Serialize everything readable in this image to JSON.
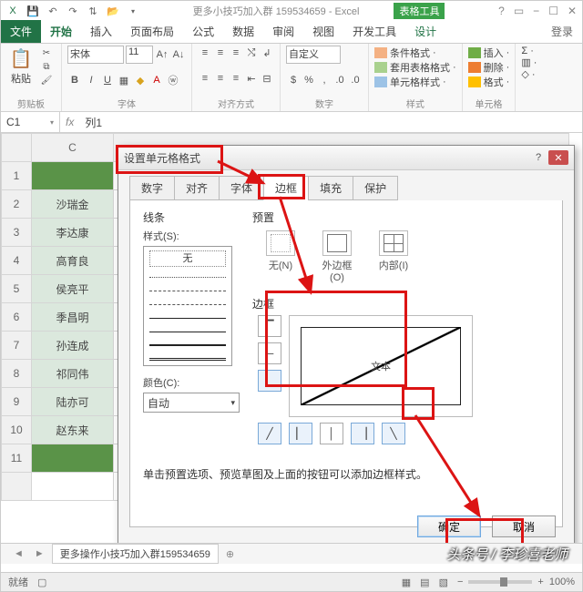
{
  "app": {
    "qat_icons": [
      "xl",
      "save",
      "undo",
      "redo",
      "sort",
      "open"
    ],
    "title_doc": "更多小技巧加入群 159534659 - Excel",
    "table_tools": "表格工具",
    "window_controls": [
      "?",
      "□",
      "−",
      "✕"
    ]
  },
  "tabs": {
    "file": "文件",
    "items": [
      "开始",
      "插入",
      "页面布局",
      "公式",
      "数据",
      "审阅",
      "视图",
      "开发工具",
      "设计"
    ],
    "active": "开始",
    "login": "登录"
  },
  "ribbon": {
    "clipboard": {
      "paste": "粘贴",
      "label": "剪贴板"
    },
    "font": {
      "name": "宋体",
      "size": "11",
      "label": "字体"
    },
    "align": {
      "label": "对齐方式"
    },
    "number": {
      "format": "自定义",
      "label": "数字"
    },
    "styles": {
      "cond": "条件格式",
      "tbl": "套用表格格式",
      "cell": "单元格样式",
      "label": "样式"
    },
    "cells": {
      "ins": "插入",
      "del": "删除",
      "fmt": "格式",
      "label": "单元格"
    }
  },
  "formula_bar": {
    "name": "C1",
    "content": "列1"
  },
  "grid": {
    "col_header": "C",
    "rows": [
      "1",
      "2",
      "3",
      "4",
      "5",
      "6",
      "7",
      "8",
      "9",
      "10",
      "11"
    ],
    "data": [
      "",
      "沙瑞金",
      "李达康",
      "高育良",
      "侯亮平",
      "季昌明",
      "孙连成",
      "祁同伟",
      "陆亦可",
      "赵东来",
      ""
    ]
  },
  "sheet_tab": "更多操作小技巧加入群159534659",
  "status": {
    "ready": "就绪",
    "scroll": "📜",
    "views": [
      "▦",
      "▤",
      "▧"
    ],
    "zoom": "100%"
  },
  "dialog": {
    "title": "设置单元格格式",
    "tabs": [
      "数字",
      "对齐",
      "字体",
      "边框",
      "填充",
      "保护"
    ],
    "active_tab": "边框",
    "line_section": "线条",
    "style_label": "样式(S):",
    "style_none": "无",
    "color_label": "颜色(C):",
    "color_value": "自动",
    "preset_section": "预置",
    "presets": [
      {
        "key": "none",
        "label": "无(N)"
      },
      {
        "key": "outline",
        "label": "外边框(O)"
      },
      {
        "key": "inside",
        "label": "内部(I)"
      }
    ],
    "border_section": "边框",
    "preview_text": "文本",
    "hint": "单击预置选项、预览草图及上面的按钮可以添加边框样式。",
    "ok": "确定",
    "cancel": "取消"
  },
  "watermark": "头条号 / 李珍喜老师"
}
